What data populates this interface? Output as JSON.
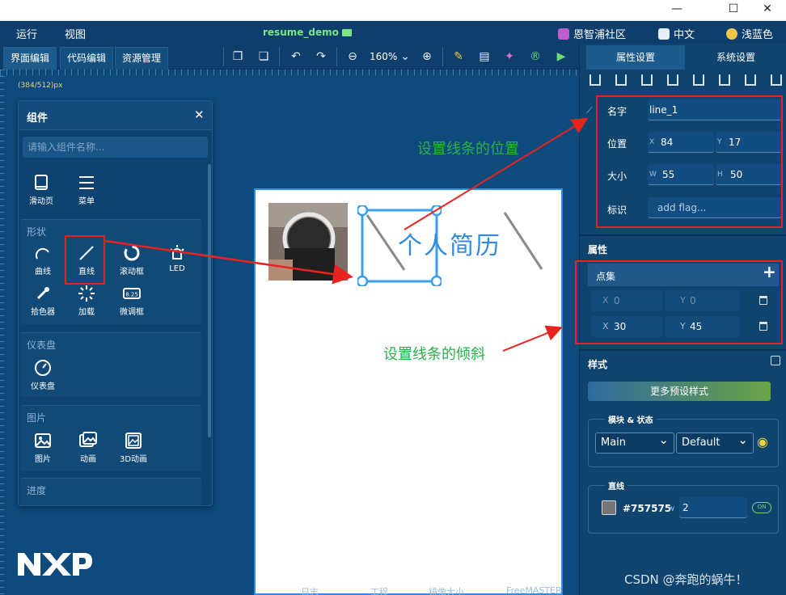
{
  "menu": {
    "run": "运行",
    "view": "视图",
    "project": "resume_demo",
    "community": "恩智浦社区",
    "lang": "中文",
    "theme": "浅蓝色"
  },
  "window_controls": {
    "min": "—",
    "max": "☐",
    "close": "✕"
  },
  "tabs": {
    "ui_edit": "界面编辑",
    "code_edit": "代码编辑",
    "resource": "资源管理"
  },
  "zoom": "160%",
  "canvas": {
    "coord": "(384/512)px",
    "title": "个人简历"
  },
  "components": {
    "title": "组件",
    "search_placeholder": "请输入组件名称...",
    "top_items": [
      "滑动页",
      "菜单"
    ],
    "shapes_title": "形状",
    "shapes": [
      "曲线",
      "直线",
      "滚动框",
      "LED",
      "拾色器",
      "加载",
      "微调框"
    ],
    "gauge_title": "仪表盘",
    "gauge_items": [
      "仪表盘"
    ],
    "image_title": "图片",
    "image_items": [
      "图片",
      "动画",
      "3D动画"
    ],
    "progress_title": "进度"
  },
  "right_tabs": {
    "props": "属性设置",
    "system": "系统设置"
  },
  "props": {
    "name_label": "名字",
    "name": "line_1",
    "pos_label": "位置",
    "x_label": "X",
    "x": "84",
    "y_label": "Y",
    "y": "17",
    "size_label": "大小",
    "w_label": "W",
    "w": "55",
    "h_label": "H",
    "h": "50",
    "flag_label": "标识",
    "flag_placeholder": "add flag..."
  },
  "attr": {
    "title": "属性",
    "points_title": "点集",
    "add": "+",
    "points": [
      {
        "x_label": "X",
        "x": "0",
        "y_label": "Y",
        "y": "0"
      },
      {
        "x_label": "X",
        "x": "30",
        "y_label": "Y",
        "y": "45"
      }
    ]
  },
  "style": {
    "title": "样式",
    "preset_button": "更多预设样式",
    "part_state_title": "模块 & 状态",
    "part": "Main",
    "state": "Default",
    "line_title": "直线",
    "color": "#757575",
    "w_label": "w",
    "width": "2",
    "toggle": "ON"
  },
  "annotations": {
    "position": "设置线条的位置",
    "tilt": "设置线条的倾斜"
  },
  "statusbar": [
    "日志",
    "工程",
    "镜像大小",
    "FreeMASTER"
  ],
  "watermark": "CSDN @奔跑的蜗牛！",
  "colors": {
    "accent_green": "#29b14b",
    "red": "#e8231f",
    "line_gray": "#757575"
  }
}
